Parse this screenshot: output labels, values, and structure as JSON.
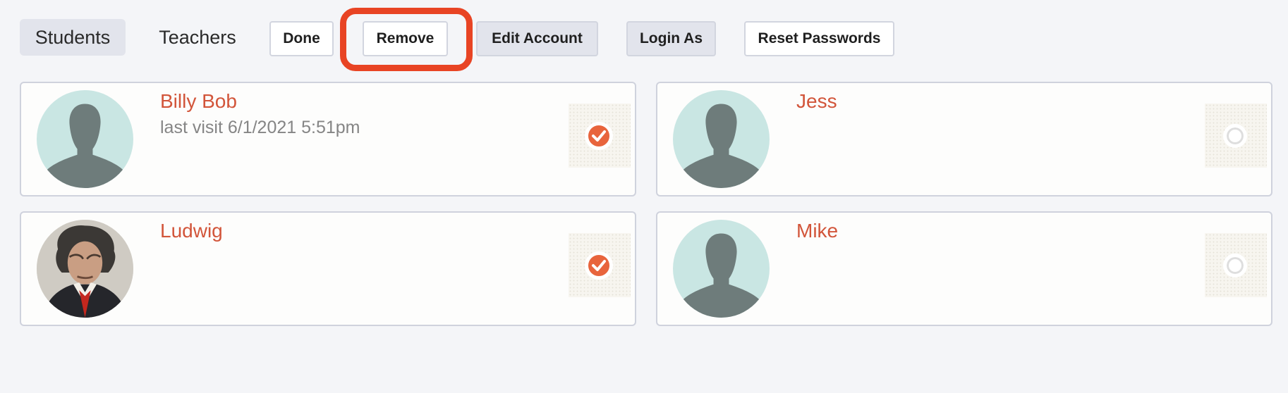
{
  "toolbar": {
    "tabs": [
      {
        "label": "Students",
        "active": true
      },
      {
        "label": "Teachers",
        "active": false
      }
    ],
    "buttons": {
      "done": "Done",
      "remove": "Remove",
      "edit_account": "Edit Account",
      "login_as": "Login As",
      "reset_passwords": "Reset Passwords"
    },
    "highlighted_button": "remove"
  },
  "students": [
    {
      "name": "Billy Bob",
      "last_visit": "last visit 6/1/2021 5:51pm",
      "avatar": "silhouette-icon",
      "selected": true
    },
    {
      "name": "Jess",
      "last_visit": "",
      "avatar": "silhouette-icon",
      "selected": false
    },
    {
      "name": "Ludwig",
      "last_visit": "",
      "avatar": "portrait-photo",
      "selected": true
    },
    {
      "name": "Mike",
      "last_visit": "",
      "avatar": "silhouette-icon",
      "selected": false
    }
  ],
  "colors": {
    "accent": "#d2553a",
    "check": "#e8643c",
    "highlight": "#e84424",
    "avatar_bg": "#c9e6e3",
    "silhouette": "#6e7c7b"
  }
}
